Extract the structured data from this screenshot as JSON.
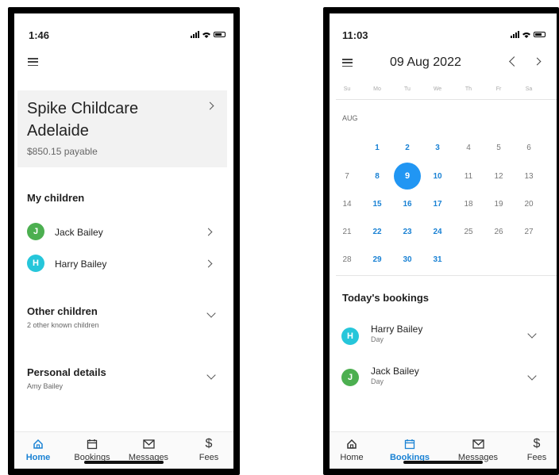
{
  "screen1": {
    "status_time": "1:46",
    "provider_name": "Spike Childcare Adelaide",
    "payable": "$850.15 payable",
    "my_children_heading": "My children",
    "children": [
      {
        "initial": "J",
        "name": "Jack Bailey",
        "color": "#4caf50"
      },
      {
        "initial": "H",
        "name": "Harry Bailey",
        "color": "#26c6da"
      }
    ],
    "other_children_heading": "Other children",
    "other_children_sub": "2 other known children",
    "personal_details_heading": "Personal details",
    "personal_details_sub": "Amy Bailey"
  },
  "screen2": {
    "status_time": "11:03",
    "date_title": "09 Aug 2022",
    "weekdays": [
      "Su",
      "Mo",
      "Tu",
      "We",
      "Th",
      "Fr",
      "Sa"
    ],
    "month_label": "AUG",
    "selected_day": "9",
    "todays_bookings_heading": "Today's bookings",
    "bookings": [
      {
        "initial": "H",
        "name": "Harry Bailey",
        "type": "Day",
        "color": "#26c6da"
      },
      {
        "initial": "J",
        "name": "Jack Bailey",
        "type": "Day",
        "color": "#4caf50"
      }
    ]
  },
  "tabs": [
    "Home",
    "Bookings",
    "Messages",
    "Fees"
  ],
  "colors": {
    "accent": "#1a82d4",
    "selected_day": "#2196f3"
  }
}
